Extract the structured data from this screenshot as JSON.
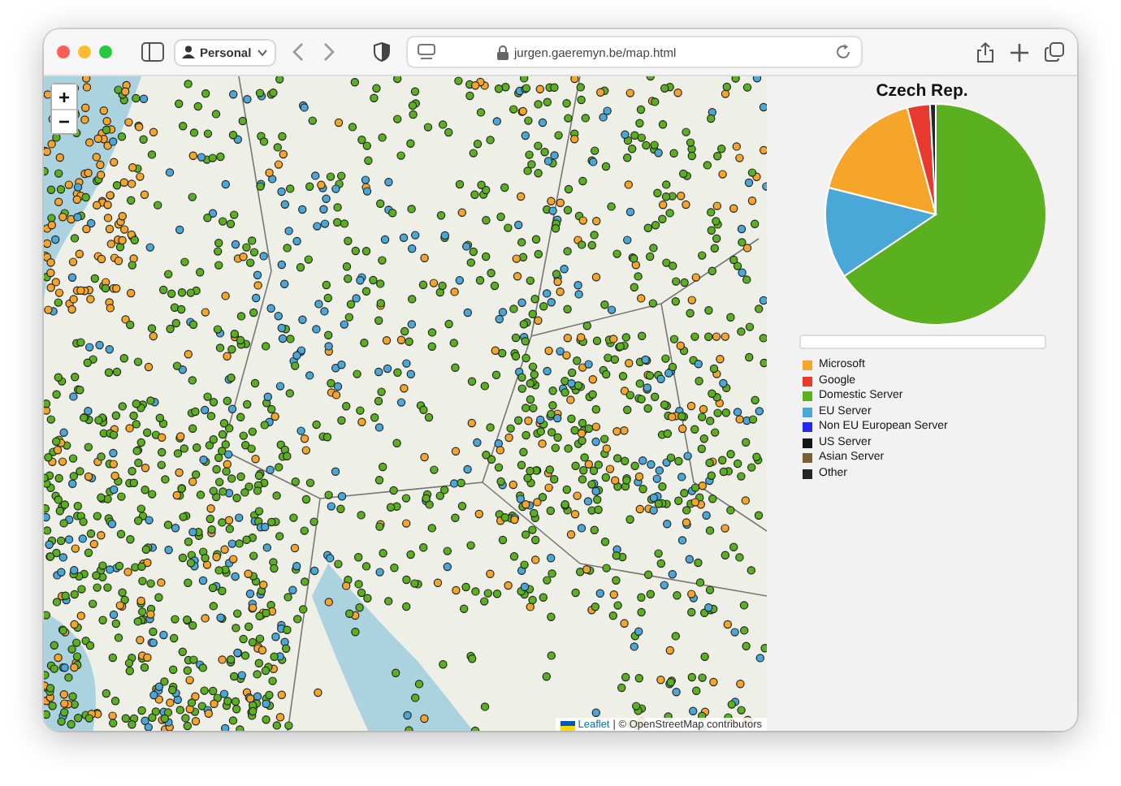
{
  "browser": {
    "profile": "Personal",
    "url": "jurgen.gaeremyn.be/map.html"
  },
  "map": {
    "zoom_in": "+",
    "zoom_out": "−",
    "attribution": {
      "link": "Leaflet",
      "text": "| © OpenStreetMap contributors"
    }
  },
  "panel": {
    "title": "Czech Rep.",
    "legend": [
      {
        "label": "Microsoft",
        "color": "#f5a52a"
      },
      {
        "label": "Google",
        "color": "#e8392f"
      },
      {
        "label": "Domestic Server",
        "color": "#5bb020"
      },
      {
        "label": "EU Server",
        "color": "#4aa8d8"
      },
      {
        "label": "Non EU European Server",
        "color": "#2727ef"
      },
      {
        "label": "US Server",
        "color": "#161616"
      },
      {
        "label": "Asian Server",
        "color": "#7a6034"
      },
      {
        "label": "Other",
        "color": "#262626"
      }
    ]
  }
}
